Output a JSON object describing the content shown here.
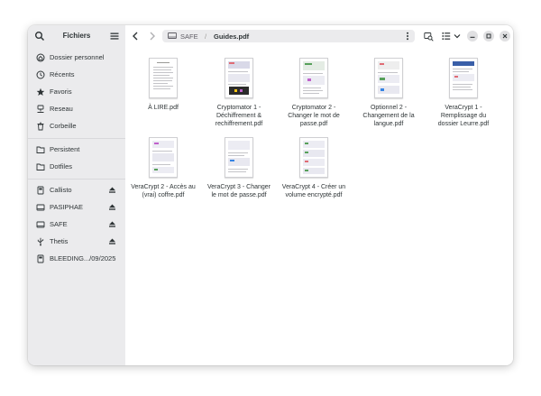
{
  "sidebar": {
    "title": "Fichiers",
    "icons": {
      "search": "search-icon",
      "menu": "hamburger-menu-icon"
    },
    "places": [
      {
        "label": "Dossier personnel",
        "icon": "home-icon"
      },
      {
        "label": "Récents",
        "icon": "clock-icon"
      },
      {
        "label": "Favoris",
        "icon": "star-icon"
      },
      {
        "label": "Reseau",
        "icon": "network-icon"
      },
      {
        "label": "Corbeille",
        "icon": "trash-icon"
      }
    ],
    "bookmarks": [
      {
        "label": "Persistent",
        "icon": "folder-icon"
      },
      {
        "label": "Dotfiles",
        "icon": "folder-icon"
      }
    ],
    "devices": [
      {
        "label": "Callisto",
        "icon": "drive-icon",
        "eject": true
      },
      {
        "label": "PASIPHAE",
        "icon": "laptop-drive-icon",
        "eject": true
      },
      {
        "label": "SAFE",
        "icon": "laptop-drive-icon",
        "eject": true
      },
      {
        "label": "Thetis",
        "icon": "usb-icon",
        "eject": true
      },
      {
        "label": "BLEEDING.../09/2025",
        "icon": "drive-icon",
        "eject": false
      }
    ]
  },
  "toolbar": {
    "path": [
      "SAFE",
      "Guides.pdf"
    ],
    "separator": "/",
    "icons": [
      "back-arrow-icon",
      "forward-arrow-icon",
      "more-vertical-icon",
      "search-icon",
      "list-view-icon",
      "chevron-down-icon",
      "minimize-icon",
      "maximize-icon",
      "close-icon"
    ]
  },
  "files": [
    {
      "name": "À LIRE.pdf"
    },
    {
      "name": "Cryptomator 1 - Déchiffrement & rechiffrement.pdf"
    },
    {
      "name": "Cryptomator 2 - Changer le mot de passe.pdf"
    },
    {
      "name": "Optionnel 2 - Changement de la langue.pdf"
    },
    {
      "name": "VeraCrypt 1 - Remplissage du dossier Leurre.pdf"
    },
    {
      "name": "VeraCrypt 2 - Accès au (vrai) coffre.pdf"
    },
    {
      "name": "VeraCrypt 3 - Changer le mot de passe.pdf"
    },
    {
      "name": "VeraCrypt 4 - Créer un volume encrypté.pdf"
    }
  ]
}
